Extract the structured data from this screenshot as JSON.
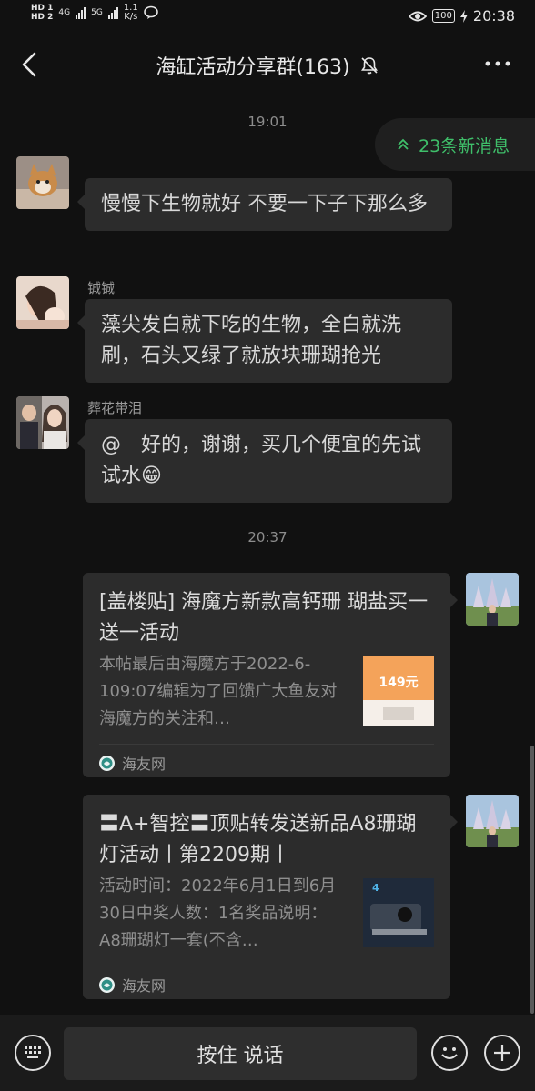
{
  "status_bar": {
    "hd1": "HD 1",
    "hd2": "HD 2",
    "net1": "4G",
    "net2": "5G",
    "speed_value": "1.1",
    "speed_unit": "K/s",
    "battery": "100",
    "time": "20:38"
  },
  "header": {
    "title": "海缸活动分享群(163)"
  },
  "new_messages": "23条新消息",
  "timestamps": [
    "19:01",
    "20:37"
  ],
  "messages": [
    {
      "sender": "",
      "text": "慢慢下生物就好 不要一下子下那么多"
    },
    {
      "sender": "铖铖",
      "text": "藻尖发白就下吃的生物，全白就洗刷，石头又绿了就放块珊瑚抢光"
    },
    {
      "sender": "葬花带泪",
      "text": "@　好的，谢谢，买几个便宜的先试试水😁"
    }
  ],
  "cards": [
    {
      "title": "[盖楼贴] 海魔方新款高钙珊 瑚盐买一送一活动",
      "desc": "本帖最后由海魔方于2022-6-109:07编辑为了回馈广大鱼友对海魔方的关注和…",
      "thumb_text": "149元",
      "source": "海友网"
    },
    {
      "title": "〓A+智控〓顶贴转发送新品A8珊瑚灯活动丨第2209期丨",
      "desc": "活动时间：2022年6月1日到6月30日中奖人数：1名奖品说明：A8珊瑚灯一套(不含…",
      "thumb_text": "4",
      "source": "海友网"
    }
  ],
  "bottom_bar": {
    "talk_label": "按住 说话"
  },
  "colors": {
    "background": "#111111",
    "bubble": "#2c2c2c",
    "accent_green": "#3fbf6a"
  }
}
